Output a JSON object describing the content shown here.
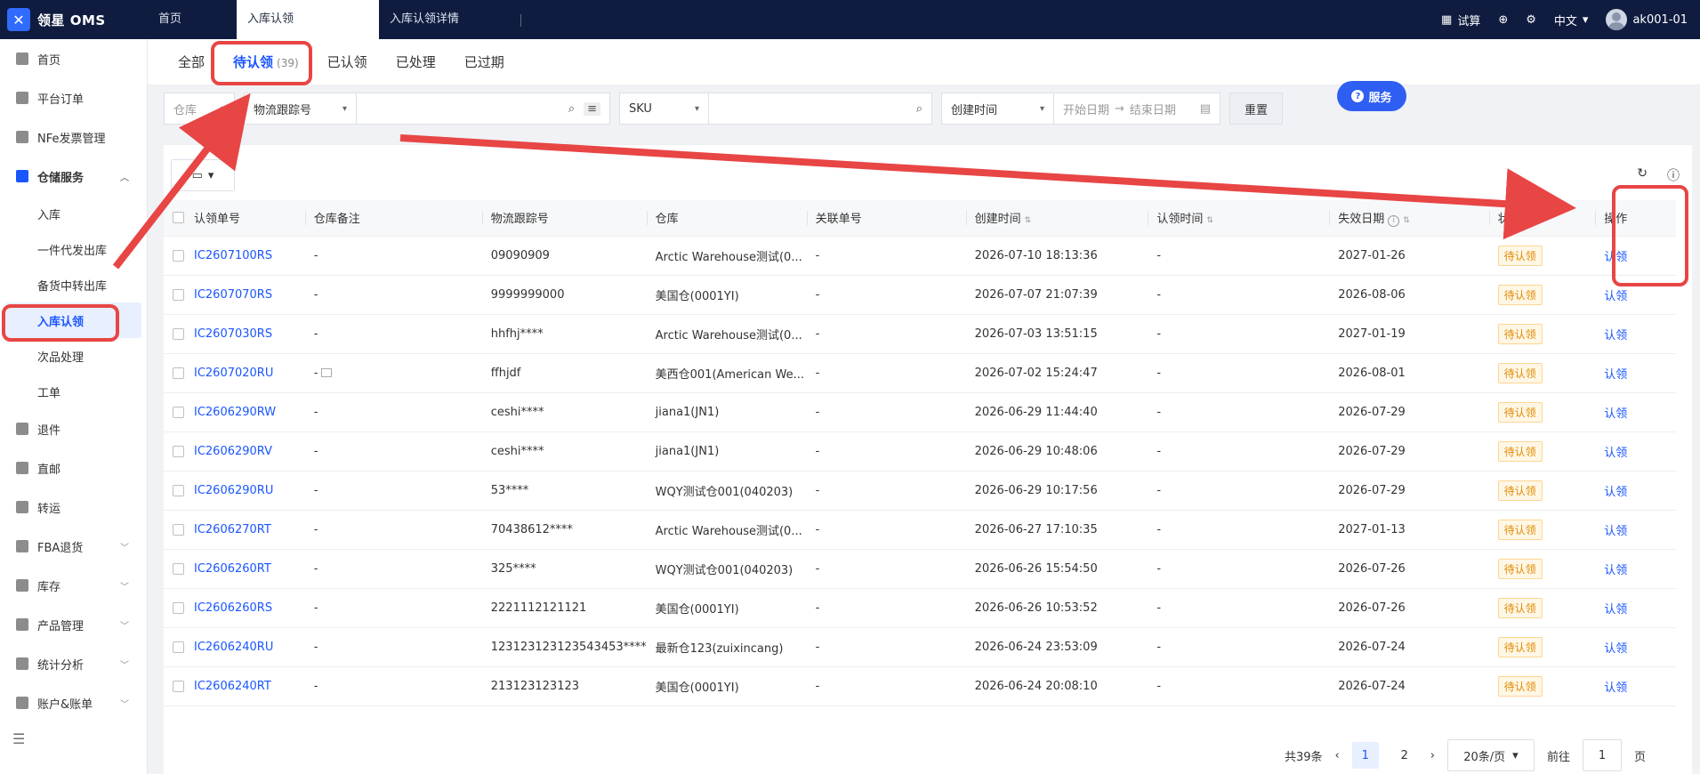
{
  "app": {
    "title": "领星 OMS"
  },
  "top_tabs": [
    {
      "label": "首页"
    },
    {
      "label": "入库认领"
    },
    {
      "label": "入库认领详情"
    }
  ],
  "top_right": {
    "trial_label": "试算",
    "language": "中文",
    "username": "ak001-01"
  },
  "sidebar": {
    "items": [
      {
        "label": "首页",
        "icon": "home-icon"
      },
      {
        "label": "平台订单",
        "icon": "order-icon"
      },
      {
        "label": "NFe发票管理",
        "icon": "invoice-icon"
      },
      {
        "label": "仓储服务",
        "icon": "warehouse-icon"
      },
      {
        "label": "退件",
        "icon": "return-icon"
      },
      {
        "label": "直邮",
        "icon": "mail-icon"
      },
      {
        "label": "转运",
        "icon": "transfer-icon"
      },
      {
        "label": "FBA退货",
        "icon": "fba-icon"
      },
      {
        "label": "库存",
        "icon": "inventory-icon"
      },
      {
        "label": "产品管理",
        "icon": "product-icon"
      },
      {
        "label": "统计分析",
        "icon": "stats-icon"
      },
      {
        "label": "账户&账单",
        "icon": "account-icon"
      }
    ],
    "sub_items": [
      {
        "label": "入库"
      },
      {
        "label": "一件代发出库"
      },
      {
        "label": "备货中转出库"
      },
      {
        "label": "入库认领"
      },
      {
        "label": "次品处理"
      },
      {
        "label": "工单"
      }
    ]
  },
  "status_tabs": [
    {
      "label": "全部"
    },
    {
      "label": "待认领",
      "count": "(39)"
    },
    {
      "label": "已认领"
    },
    {
      "label": "已处理"
    },
    {
      "label": "已过期"
    }
  ],
  "filters": {
    "warehouse_placeholder": "仓库",
    "tracking_select": "物流跟踪号",
    "sku_select": "SKU",
    "time_select": "创建时间",
    "start_date": "开始日期",
    "end_date": "结束日期",
    "reset_label": "重置"
  },
  "service_label": "服务",
  "table": {
    "headers": [
      "认领单号",
      "仓库备注",
      "物流跟踪号",
      "仓库",
      "关联单号",
      "创建时间",
      "认领时间",
      "失效日期",
      "状态",
      "操作"
    ],
    "rows": [
      {
        "id": "IC2607100RS",
        "note": "-",
        "tracking": "09090909",
        "warehouse": "Arctic Warehouse测试(0...",
        "related": "-",
        "created": "2026-07-10 18:13:36",
        "claimed": "-",
        "expire": "2027-01-26",
        "status": "待认领",
        "action": "认领"
      },
      {
        "id": "IC2607070RS",
        "note": "-",
        "tracking": "9999999000",
        "warehouse": "美国仓(0001YI)",
        "related": "-",
        "created": "2026-07-07 21:07:39",
        "claimed": "-",
        "expire": "2026-08-06",
        "status": "待认领",
        "action": "认领"
      },
      {
        "id": "IC2607030RS",
        "note": "-",
        "tracking": "hhfhj****",
        "warehouse": "Arctic Warehouse测试(0...",
        "related": "-",
        "created": "2026-07-03 13:51:15",
        "claimed": "-",
        "expire": "2027-01-19",
        "status": "待认领",
        "action": "认领"
      },
      {
        "id": "IC2607020RU",
        "note": "-",
        "tracking": "ffhjdf",
        "warehouse": "美西仓001(American We...",
        "related": "-",
        "created": "2026-07-02 15:24:47",
        "claimed": "-",
        "expire": "2026-08-01",
        "status": "待认领",
        "action": "认领"
      },
      {
        "id": "IC2606290RW",
        "note": "-",
        "tracking": "ceshi****",
        "warehouse": "jiana1(JN1)",
        "related": "-",
        "created": "2026-06-29 11:44:40",
        "claimed": "-",
        "expire": "2026-07-29",
        "status": "待认领",
        "action": "认领"
      },
      {
        "id": "IC2606290RV",
        "note": "-",
        "tracking": "ceshi****",
        "warehouse": "jiana1(JN1)",
        "related": "-",
        "created": "2026-06-29 10:48:06",
        "claimed": "-",
        "expire": "2026-07-29",
        "status": "待认领",
        "action": "认领"
      },
      {
        "id": "IC2606290RU",
        "note": "-",
        "tracking": "53****",
        "warehouse": "WQY测试仓001(040203)",
        "related": "-",
        "created": "2026-06-29 10:17:56",
        "claimed": "-",
        "expire": "2026-07-29",
        "status": "待认领",
        "action": "认领"
      },
      {
        "id": "IC2606270RT",
        "note": "-",
        "tracking": "70438612****",
        "warehouse": "Arctic Warehouse测试(0...",
        "related": "-",
        "created": "2026-06-27 17:10:35",
        "claimed": "-",
        "expire": "2027-01-13",
        "status": "待认领",
        "action": "认领"
      },
      {
        "id": "IC2606260RT",
        "note": "-",
        "tracking": "325****",
        "warehouse": "WQY测试仓001(040203)",
        "related": "-",
        "created": "2026-06-26 15:54:50",
        "claimed": "-",
        "expire": "2026-07-26",
        "status": "待认领",
        "action": "认领"
      },
      {
        "id": "IC2606260RS",
        "note": "-",
        "tracking": "2221112121121",
        "warehouse": "美国仓(0001YI)",
        "related": "-",
        "created": "2026-06-26 10:53:52",
        "claimed": "-",
        "expire": "2026-07-26",
        "status": "待认领",
        "action": "认领"
      },
      {
        "id": "IC2606240RU",
        "note": "-",
        "tracking": "123123123123543453****",
        "warehouse": "最新仓123(zuixincang)",
        "related": "-",
        "created": "2026-06-24 23:53:09",
        "claimed": "-",
        "expire": "2026-07-24",
        "status": "待认领",
        "action": "认领"
      },
      {
        "id": "IC2606240RT",
        "note": "-",
        "tracking": "213123123123",
        "warehouse": "美国仓(0001YI)",
        "related": "-",
        "created": "2026-06-24 20:08:10",
        "claimed": "-",
        "expire": "2026-07-24",
        "status": "待认领",
        "action": "认领"
      }
    ]
  },
  "pagination": {
    "total": "共39条",
    "pages": [
      "1",
      "2"
    ],
    "page_size": "20条/页",
    "goto_label": "前往",
    "goto_value": "1",
    "page_suffix": "页"
  },
  "annotation_color": "#e84545"
}
